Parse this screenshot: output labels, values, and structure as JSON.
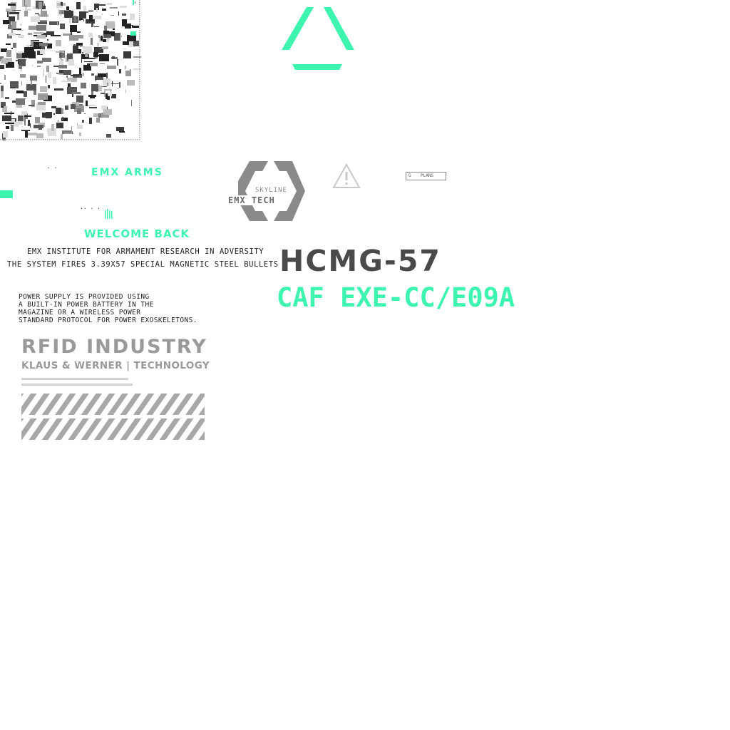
{
  "brand": "EMX ARMS",
  "welcome": "WELCOME BACK",
  "institute": "EMX INSTITUTE FOR ARMAMENT RESEARCH IN ADVERSITY",
  "system_fires": "THE SYSTEM FIRES 3.39X57 SPECIAL MAGNETIC STEEL BULLETS",
  "power_text": "POWER SUPPLY IS PROVIDED USING\nA BUILT-IN POWER BATTERY IN THE\nMAGAZINE OR A WIRELESS POWER\nSTANDARD PROTOCOL FOR POWER EXOSKELETONS.",
  "rfid": "RFID INDUSTRY",
  "klaus": "KLAUS & WERNER | TECHNOLOGY",
  "logo": {
    "line1": "SKYLINE",
    "line2": "EMX TECH"
  },
  "model": "HCMG-57",
  "code": "CAF EXE-CC/E09A",
  "tag_text": "PLANS",
  "colors": {
    "accent": "#3ef5b0",
    "grey": "#9a9a9a",
    "dark": "#4a4a4a"
  },
  "icons": [
    "triangle-logo",
    "warning-icon",
    "circuit-pattern",
    "hatch-bar"
  ]
}
